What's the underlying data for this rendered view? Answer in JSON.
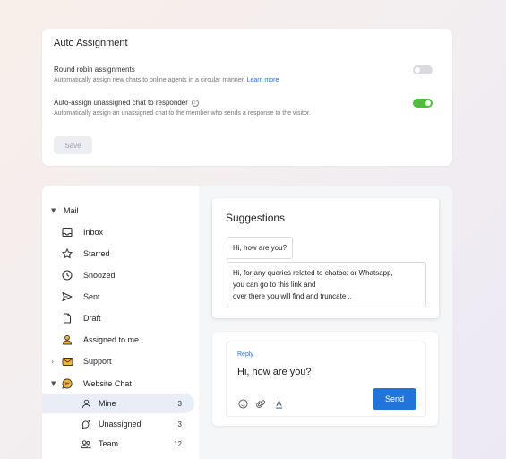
{
  "auto_assignment": {
    "title": "Auto Assignment",
    "round_robin": {
      "title": "Round robin assignments",
      "description": "Automatically assign new chats to online agents in a circular manner.",
      "link": "Learn more",
      "enabled": false
    },
    "auto_assign": {
      "title": "Auto-assign unassigned chat to responder",
      "description": "Automatically assign an unassigned chat to the member who sends a response to the visitor.",
      "enabled": true
    },
    "save_label": "Save"
  },
  "sidebar": {
    "mail_label": "Mail",
    "items": [
      {
        "label": "Inbox",
        "icon": "inbox-icon"
      },
      {
        "label": "Starred",
        "icon": "star-icon"
      },
      {
        "label": "Snoozed",
        "icon": "clock-icon"
      },
      {
        "label": "Sent",
        "icon": "send-icon"
      },
      {
        "label": "Draft",
        "icon": "document-icon"
      },
      {
        "label": "Assigned to me",
        "icon": "person-icon"
      },
      {
        "label": "Support",
        "icon": "envelope-icon"
      },
      {
        "label": "Website Chat",
        "icon": "chat-icon"
      }
    ],
    "sub_items": [
      {
        "label": "Mine",
        "count": "3",
        "icon": "person-icon"
      },
      {
        "label": "Unassigned",
        "count": "3",
        "icon": "chat-add-icon"
      },
      {
        "label": "Team",
        "count": "12",
        "icon": "team-icon"
      }
    ]
  },
  "suggestions": {
    "title": "Suggestions",
    "chip1": "Hi, how are you?",
    "chip2_line1": "Hi, for any queries related to chatbot or Whatsapp,",
    "chip2_line2": "you can go to this link and",
    "chip2_line3": "over there you will find and truncate..."
  },
  "reply": {
    "label": "Reply",
    "text": "Hi, how are you?",
    "send_label": "Send"
  },
  "colors": {
    "accent": "#2374d8",
    "toggle_on": "#4fbe3c",
    "toggle_off": "#d9dbe0",
    "active_row": "#e9edf7"
  }
}
